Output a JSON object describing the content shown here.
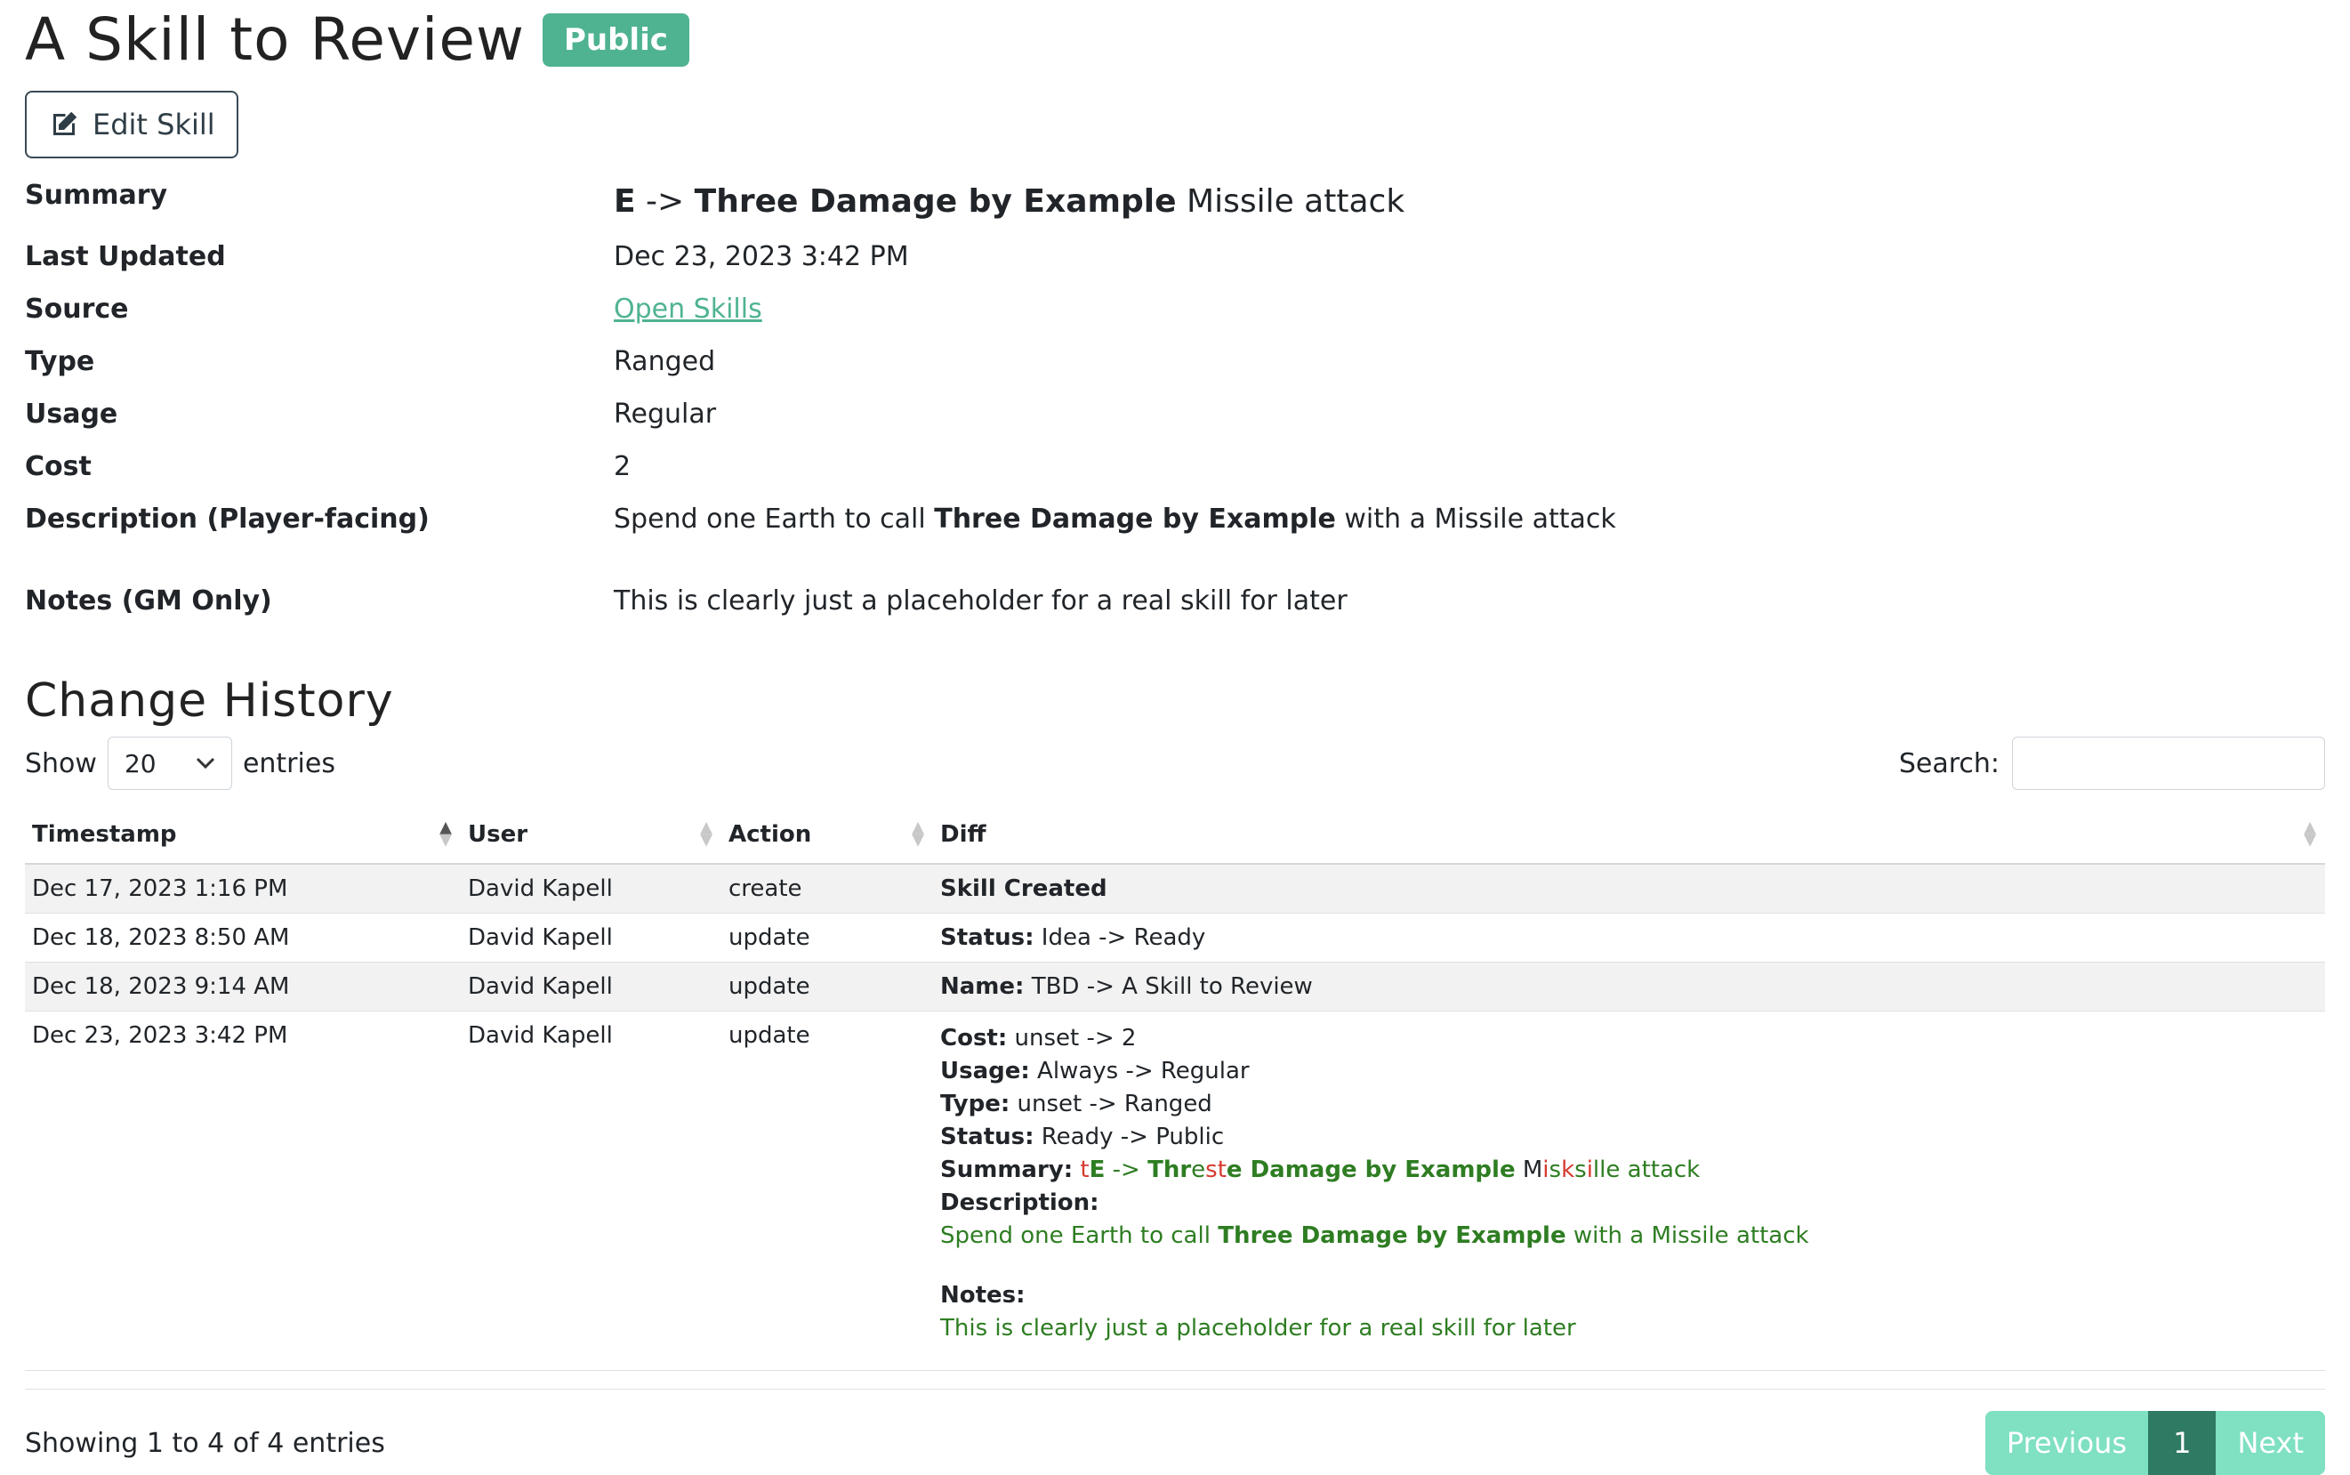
{
  "header": {
    "title": "A Skill to Review",
    "badge": "Public",
    "edit_label": "Edit Skill"
  },
  "details": {
    "summary_label": "Summary",
    "summary": {
      "part1": "E",
      "arrow": " -> ",
      "bold": "Three Damage by Example",
      "rest": " Missile attack"
    },
    "last_updated_label": "Last Updated",
    "last_updated": "Dec 23, 2023 3:42 PM",
    "source_label": "Source",
    "source": "Open Skills",
    "type_label": "Type",
    "type": "Ranged",
    "usage_label": "Usage",
    "usage": "Regular",
    "cost_label": "Cost",
    "cost": "2",
    "description_label": "Description (Player-facing)",
    "description": {
      "pre": "Spend one Earth to call ",
      "bold": "Three Damage by Example",
      "post": " with a Missile attack"
    },
    "notes_label": "Notes (GM Only)",
    "notes": "This is clearly just a placeholder for a real skill for later"
  },
  "history": {
    "title": "Change History",
    "show_label": "Show",
    "entries_label": "entries",
    "page_size": "20",
    "search_label": "Search:",
    "search_value": "",
    "columns": [
      "Timestamp",
      "User",
      "Action",
      "Diff"
    ],
    "rows": [
      {
        "timestamp": "Dec 17, 2023 1:16 PM",
        "user": "David Kapell",
        "action": "create",
        "diff_label": "Skill Created",
        "diff_value": ""
      },
      {
        "timestamp": "Dec 18, 2023 8:50 AM",
        "user": "David Kapell",
        "action": "update",
        "diff_label": "Status:",
        "diff_value": " Idea -> Ready"
      },
      {
        "timestamp": "Dec 18, 2023 9:14 AM",
        "user": "David Kapell",
        "action": "update",
        "diff_label": "Name:",
        "diff_value": " TBD -> A Skill to Review"
      },
      {
        "timestamp": "Dec 23, 2023 3:42 PM",
        "user": "David Kapell",
        "action": "update"
      }
    ],
    "big_diff": {
      "cost_label": "Cost:",
      "cost_value": " unset -> 2",
      "usage_label": "Usage:",
      "usage_value": " Always -> Regular",
      "type_label": "Type:",
      "type_value": " unset -> Ranged",
      "status_label": "Status:",
      "status_value": " Ready -> Public",
      "summary_label": "Summary:",
      "description_label": "Description:",
      "description_pre": "Spend one Earth to call ",
      "description_bold": "Three Damage by Example",
      "description_post": " with a Missile attack",
      "notes_label": "Notes:",
      "notes_value": "This is clearly just a placeholder for a real skill for later"
    },
    "info": "Showing 1 to 4 of 4 entries",
    "prev_label": "Previous",
    "current_page": "1",
    "next_label": "Next"
  }
}
